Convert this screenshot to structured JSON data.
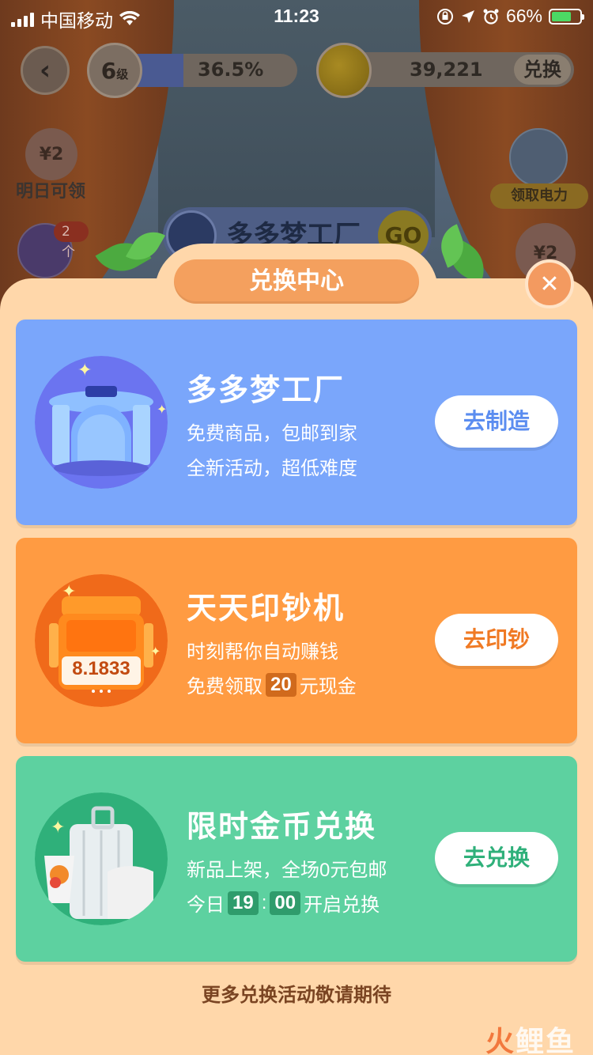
{
  "status_bar": {
    "carrier": "中国移动",
    "time": "11:23",
    "battery": "66%"
  },
  "game_header": {
    "level_number": "6",
    "level_unit": "级",
    "level_progress": "36.5%",
    "level_progress_fraction": 0.365,
    "coins": "39,221",
    "exchange_label": "兑换"
  },
  "background": {
    "redpack_amount": "¥2",
    "tomorrow_label": "明日可领",
    "gift_count": "2个",
    "power_label": "领取电力",
    "right_redpack": "¥2",
    "banner_text": "多多梦工厂",
    "banner_go": "GO"
  },
  "sheet": {
    "title": "兑换中心",
    "close_symbol": "✕"
  },
  "cards": [
    {
      "title": "多多梦工厂",
      "line1": "免费商品，包邮到家",
      "line2": "全新活动，超低难度",
      "button": "去制造",
      "color": "#7aa6fb"
    },
    {
      "title": "天天印钞机",
      "line1": "时刻帮你自动赚钱",
      "line2_prefix": "免费领取",
      "line2_value": "20",
      "line2_suffix": "元现金",
      "machine_display": "8.1833",
      "button": "去印钞",
      "color": "#ff9b42"
    },
    {
      "title": "限时金币兑换",
      "line1": "新品上架，全场0元包邮",
      "line2_prefix": "今日",
      "line2_hour": "19",
      "line2_sep": ":",
      "line2_minute": "00",
      "line2_suffix": "开启兑换",
      "button": "去兑换",
      "color": "#5dd1a0"
    }
  ],
  "footer": {
    "note": "更多兑换活动敬请期待"
  },
  "watermark": {
    "fire": "火",
    "rest": "鲤鱼"
  }
}
